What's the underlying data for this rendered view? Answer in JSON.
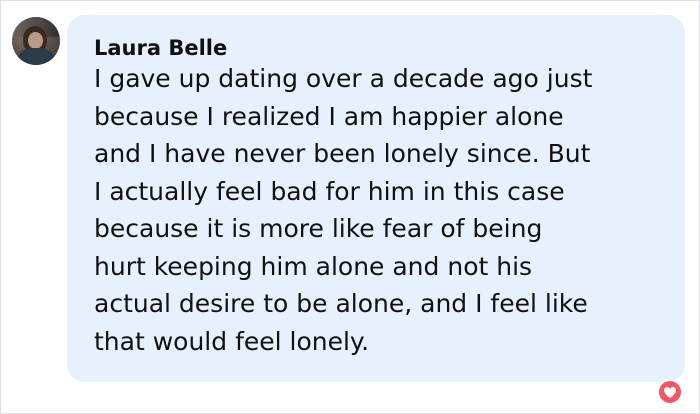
{
  "comment": {
    "author": "Laura Belle",
    "lines": [
      "I gave up dating over a decade ago just",
      "because I realized I am happier alone",
      "and I have never been lonely since. But",
      "I actually feel bad for him in this case",
      "because it is more like fear of being",
      "hurt keeping him alone and not his",
      "actual desire to be alone, and I feel like",
      "that would feel lonely."
    ]
  },
  "reaction": {
    "icon": "heart-icon",
    "color": "#f15769"
  },
  "colors": {
    "bubble": "#e6f1fd",
    "text": "#111111"
  }
}
